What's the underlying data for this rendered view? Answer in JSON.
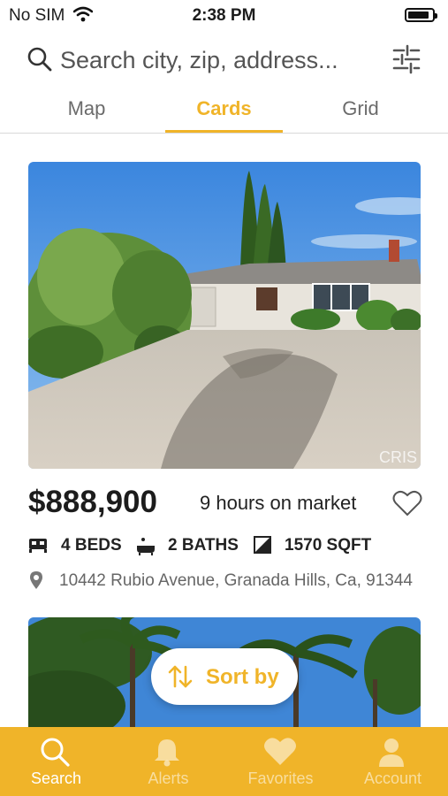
{
  "status_bar": {
    "carrier": "No SIM",
    "time": "2:38 PM",
    "battery_level": 0.9
  },
  "search": {
    "placeholder": "Search city, zip, address...",
    "search_icon": "search-icon",
    "filter_icon": "sliders-icon"
  },
  "view_tabs": [
    {
      "label": "Map",
      "active": false
    },
    {
      "label": "Cards",
      "active": true
    },
    {
      "label": "Grid",
      "active": false
    }
  ],
  "listing": {
    "price": "$888,900",
    "market_time": "9 hours on market",
    "beds": "4 BEDS",
    "baths": "2 BATHS",
    "sqft": "1570 SQFT",
    "address": "10442 Rubio Avenue, Granada Hills, Ca, 91344",
    "photo_watermark": "CRIS",
    "favorite_icon": "heart-outline-icon"
  },
  "sort_button": {
    "label": "Sort by",
    "icon": "sort-arrows-icon"
  },
  "bottom_tabs": [
    {
      "label": "Search",
      "icon": "search-icon",
      "active": true
    },
    {
      "label": "Alerts",
      "icon": "bell-icon",
      "active": false
    },
    {
      "label": "Favorites",
      "icon": "heart-icon",
      "active": false
    },
    {
      "label": "Account",
      "icon": "person-icon",
      "active": false
    }
  ],
  "colors": {
    "accent": "#f0b429",
    "tab_bar": "#f0b429",
    "text": "#1c1c1c",
    "muted": "#666666"
  }
}
